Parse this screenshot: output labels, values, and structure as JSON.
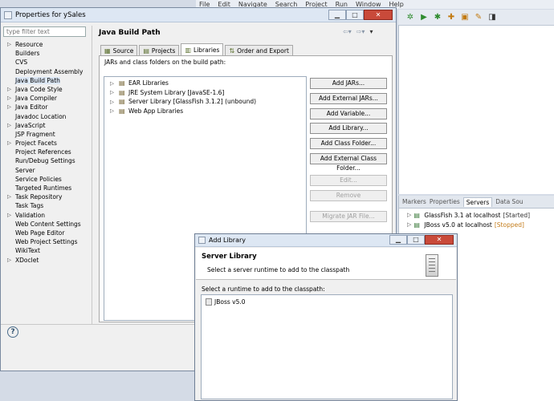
{
  "menubar": [
    "File",
    "Edit",
    "Navigate",
    "Search",
    "Project",
    "Run",
    "Window",
    "Help"
  ],
  "toolbar": {
    "icons": [
      {
        "name": "settings-gear-icon",
        "glyph": "✲",
        "cls": "g"
      },
      {
        "name": "run-icon",
        "glyph": "▶",
        "cls": "g"
      },
      {
        "name": "debug-icon",
        "glyph": "✱",
        "cls": "g"
      },
      {
        "name": "new-folder-icon",
        "glyph": "✚",
        "cls": "o"
      },
      {
        "name": "open-type-icon",
        "glyph": "▣",
        "cls": "o"
      },
      {
        "name": "edit-icon",
        "glyph": "✎",
        "cls": "o"
      },
      {
        "name": "task-icon",
        "glyph": "◨",
        "cls": "b"
      }
    ]
  },
  "servers_view": {
    "tabs": [
      "Markers",
      "Properties",
      "Servers",
      "Data Sou"
    ],
    "active_tab_index": 2,
    "rows": [
      {
        "name": "GlassFish 3.1 at localhost",
        "status": "[Started]",
        "started": true
      },
      {
        "name": "JBoss v5.0 at localhost",
        "status": "[Stopped]",
        "started": false
      }
    ]
  },
  "properties": {
    "title": "Properties for ySales",
    "filter_placeholder": "type filter text",
    "nav": [
      {
        "label": "Resource",
        "expandable": true
      },
      {
        "label": "Builders",
        "expandable": false
      },
      {
        "label": "CVS",
        "expandable": false
      },
      {
        "label": "Deployment Assembly",
        "expandable": false
      },
      {
        "label": "Java Build Path",
        "expandable": false,
        "selected": true
      },
      {
        "label": "Java Code Style",
        "expandable": true
      },
      {
        "label": "Java Compiler",
        "expandable": true
      },
      {
        "label": "Java Editor",
        "expandable": true
      },
      {
        "label": "Javadoc Location",
        "expandable": false
      },
      {
        "label": "JavaScript",
        "expandable": true
      },
      {
        "label": "JSP Fragment",
        "expandable": false
      },
      {
        "label": "Project Facets",
        "expandable": true
      },
      {
        "label": "Project References",
        "expandable": false
      },
      {
        "label": "Run/Debug Settings",
        "expandable": false
      },
      {
        "label": "Server",
        "expandable": false
      },
      {
        "label": "Service Policies",
        "expandable": false
      },
      {
        "label": "Targeted Runtimes",
        "expandable": false
      },
      {
        "label": "Task Repository",
        "expandable": true
      },
      {
        "label": "Task Tags",
        "expandable": false
      },
      {
        "label": "Validation",
        "expandable": true
      },
      {
        "label": "Web Content Settings",
        "expandable": false
      },
      {
        "label": "Web Page Editor",
        "expandable": false
      },
      {
        "label": "Web Project Settings",
        "expandable": false
      },
      {
        "label": "WikiText",
        "expandable": false
      },
      {
        "label": "XDoclet",
        "expandable": true
      }
    ],
    "page_title": "Java Build Path",
    "tabs": [
      {
        "label": "Source",
        "icon": "source-folder-icon",
        "glyph": "▦"
      },
      {
        "label": "Projects",
        "icon": "projects-icon",
        "glyph": "▤"
      },
      {
        "label": "Libraries",
        "icon": "libraries-icon",
        "glyph": "▥",
        "active": true
      },
      {
        "label": "Order and Export",
        "icon": "order-export-icon",
        "glyph": "⇅"
      }
    ],
    "panel_caption": "JARs and class folders on the build path:",
    "libraries": [
      {
        "label": "EAR Libraries",
        "icon": "library-icon"
      },
      {
        "label": "JRE System Library [JavaSE-1.6]",
        "icon": "library-icon"
      },
      {
        "label": "Server Library [GlassFish 3.1.2] (unbound)",
        "icon": "library-icon"
      },
      {
        "label": "Web App Libraries",
        "icon": "library-icon"
      }
    ],
    "buttons": [
      {
        "label": "Add JARs...",
        "name": "add-jars-button",
        "enabled": true
      },
      {
        "label": "Add External JARs...",
        "name": "add-external-jars-button",
        "enabled": true
      },
      {
        "label": "Add Variable...",
        "name": "add-variable-button",
        "enabled": true
      },
      {
        "label": "Add Library...",
        "name": "add-library-button",
        "enabled": true
      },
      {
        "label": "Add Class Folder...",
        "name": "add-class-folder-button",
        "enabled": true
      },
      {
        "label": "Add External Class Folder...",
        "name": "add-external-class-folder-button",
        "enabled": true
      },
      {
        "label": "Edit...",
        "name": "edit-button",
        "enabled": false,
        "gap_before": true
      },
      {
        "label": "Remove",
        "name": "remove-button",
        "enabled": false
      },
      {
        "label": "Migrate JAR File...",
        "name": "migrate-jar-button",
        "enabled": false,
        "gap_before": true
      }
    ]
  },
  "add_library": {
    "title": "Add Library",
    "header_title": "Server Library",
    "header_desc": "Select a server runtime to add to the classpath",
    "list_caption": "Select a runtime to add to the classpath:",
    "runtimes": [
      "JBoss v5.0"
    ]
  }
}
